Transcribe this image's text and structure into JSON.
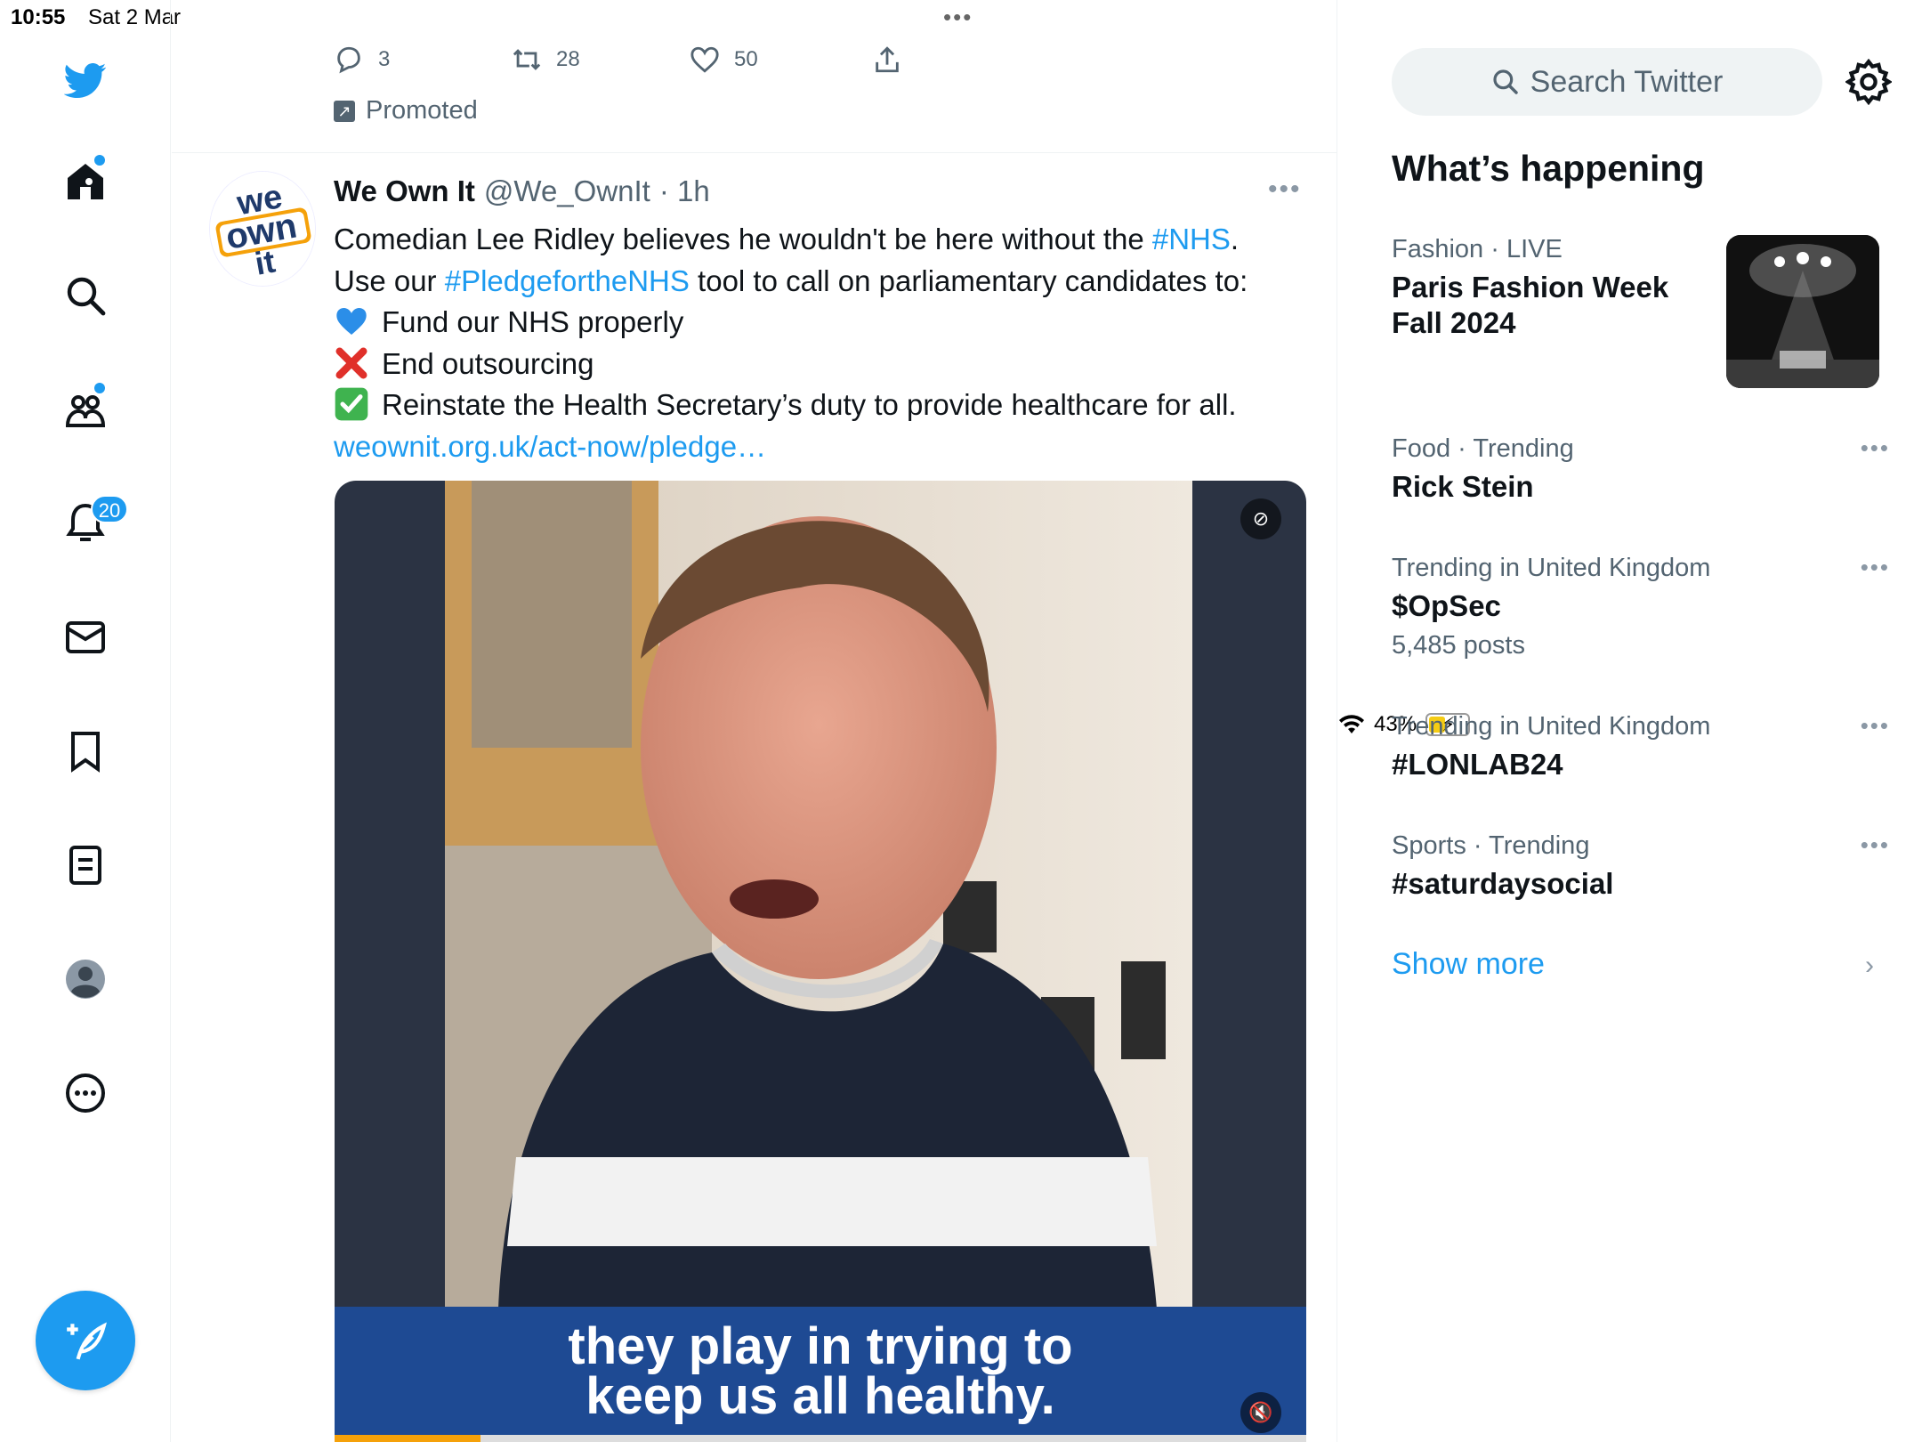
{
  "status_bar": {
    "time": "10:55",
    "date": "Sat 2 Mar",
    "battery": "43%",
    "battery_level": 0.43
  },
  "nav": {
    "icons": [
      "twitter-bird-icon",
      "home-icon",
      "search-icon",
      "communities-icon",
      "notifications-icon",
      "messages-icon",
      "bookmarks-icon",
      "lists-icon",
      "profile-icon",
      "more-icon",
      "compose-icon"
    ],
    "notifications_badge": "20"
  },
  "prev_tweet": {
    "replies": "3",
    "retweets": "28",
    "likes": "50",
    "promoted_label": "Promoted"
  },
  "tweet": {
    "name": "We Own It",
    "handle": "@We_OwnIt",
    "time": "· 1h",
    "avatar_text": [
      "we",
      "own",
      "it"
    ],
    "line1_text": "Comedian Lee Ridley believes he wouldn't be here without the ",
    "line1_tag": "#NHS",
    "line1_end": ".",
    "line2_start": "Use our ",
    "line2_tag": "#PledgefortheNHS",
    "line2_end": " tool to call on parliamentary candidates to:",
    "bullet1": "Fund our NHS properly",
    "bullet2": "End outsourcing",
    "bullet3": "Reinstate the Health Secretary’s duty to provide healthcare for all.",
    "link": "weownit.org.uk/act-now/pledge…",
    "video_caption_line1": "they play in trying to",
    "video_caption_line2": "keep us all healthy.",
    "video_progress": 0.15
  },
  "sidebar": {
    "search_placeholder": "Search Twitter",
    "whats_happening": "What’s happening",
    "trends": [
      {
        "category": "Fashion · LIVE",
        "title": "Paris Fashion Week Fall 2024"
      },
      {
        "category": "Food · Trending",
        "title": "Rick Stein"
      },
      {
        "category": "Trending in United Kingdom",
        "title": "$OpSec",
        "count": "5,485 posts"
      },
      {
        "category": "Trending in United Kingdom",
        "title": "#LONLAB24"
      },
      {
        "category": "Sports · Trending",
        "title": "#saturdaysocial"
      }
    ],
    "show_more": "Show more"
  },
  "colors": {
    "accent": "#1d9bf0",
    "text": "#0f1419",
    "secondary": "#536471",
    "caption_band": "#1e4a93"
  }
}
